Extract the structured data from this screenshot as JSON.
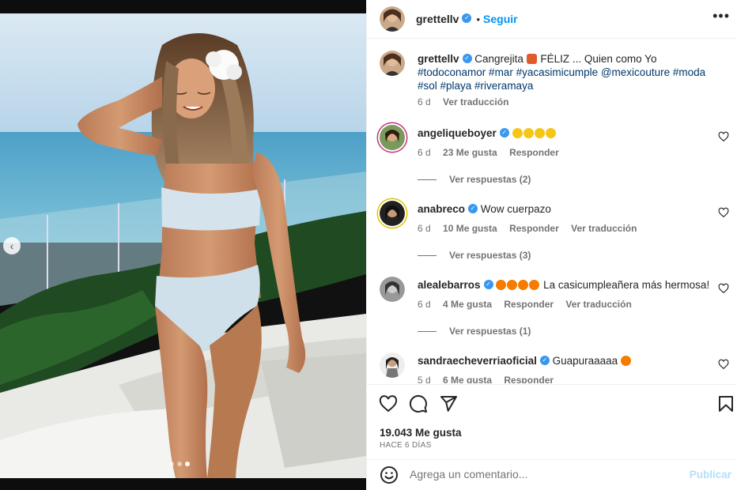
{
  "post_author": {
    "username": "grettellv",
    "follow_label": "Seguir",
    "separator": "•"
  },
  "caption": {
    "username": "grettellv",
    "text_before": "Cangrejita",
    "text_after": "FÉLIZ ... Quien como Yo",
    "hashtags_line1": "#todoconamor #mar #yacasimicumple @mexicouture #moda",
    "hashtags_line2": "#sol #playa #riveramaya",
    "time": "6 d",
    "translate": "Ver traducción"
  },
  "comments": [
    {
      "username": "angeliqueboyer",
      "text": "",
      "emoji_count": 4,
      "emoji_color": "#f5c518",
      "time": "6 d",
      "likes": "23 Me gusta",
      "reply": "Responder",
      "translate": "",
      "replies": "Ver respuestas (2)"
    },
    {
      "username": "anabreco",
      "text": "Wow cuerpazo",
      "emoji_count": 0,
      "emoji_color": "",
      "time": "6 d",
      "likes": "10 Me gusta",
      "reply": "Responder",
      "translate": "Ver traducción",
      "replies": "Ver respuestas (3)"
    },
    {
      "username": "alealebarros",
      "text": "La casicumpleañera más hermosa!",
      "emoji_count": 4,
      "emoji_color": "#f57c00",
      "time": "6 d",
      "likes": "4 Me gusta",
      "reply": "Responder",
      "translate": "Ver traducción",
      "replies": "Ver respuestas (1)"
    },
    {
      "username": "sandraecheverriaoficial",
      "text": "Guapuraaaaa",
      "emoji_count": 1,
      "emoji_color": "#f57c00",
      "time": "5 d",
      "likes": "6 Me gusta",
      "reply": "Responder",
      "translate": "",
      "replies": ""
    }
  ],
  "actions": {
    "likes": "19.043 Me gusta",
    "ago": "HACE 6 DÍAS"
  },
  "add_comment": {
    "placeholder": "Agrega un comentario...",
    "publish": "Publicar"
  },
  "icons": [
    "more-icon",
    "heart-icon",
    "comment-icon",
    "share-icon",
    "save-icon",
    "emoji-icon",
    "verified-icon",
    "chevron-left-icon"
  ],
  "colors": {
    "link": "#0095f6",
    "verified": "#3897f0",
    "muted": "#737373",
    "publish_disabled": "#b2dffc"
  }
}
